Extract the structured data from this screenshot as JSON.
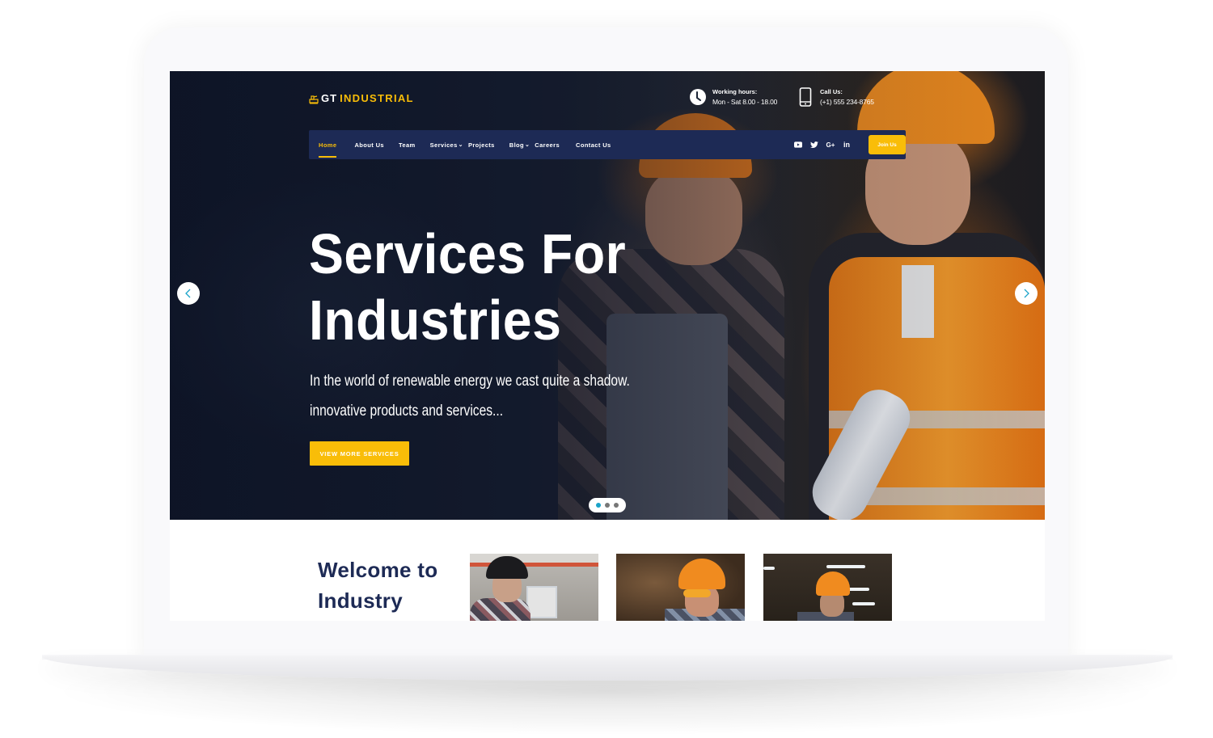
{
  "brand": {
    "prefix": "GT",
    "name": "INDUSTRIAL",
    "icon": "factory-icon",
    "accent_color": "#f9bd08",
    "navy_color": "#1d2a55"
  },
  "header_info": [
    {
      "icon": "clock-icon",
      "label": "Working hours:",
      "value": "Mon - Sat 8.00 - 18.00"
    },
    {
      "icon": "phone-icon",
      "label": "Call Us:",
      "value": "(+1) 555 234-8765"
    }
  ],
  "nav": {
    "items": [
      {
        "label": "Home",
        "active": true,
        "has_dropdown": false
      },
      {
        "label": "About Us",
        "active": false,
        "has_dropdown": false
      },
      {
        "label": "Team",
        "active": false,
        "has_dropdown": false
      },
      {
        "label": "Services",
        "active": false,
        "has_dropdown": true
      },
      {
        "label": "Projects",
        "active": false,
        "has_dropdown": false
      },
      {
        "label": "Blog",
        "active": false,
        "has_dropdown": true
      },
      {
        "label": "Careers",
        "active": false,
        "has_dropdown": false
      },
      {
        "label": "Contact Us",
        "active": false,
        "has_dropdown": false
      }
    ],
    "caret": "⌄",
    "social": [
      "youtube-icon",
      "twitter-icon",
      "google-plus-icon",
      "linkedin-icon"
    ],
    "social_glyphs": {
      "google_plus": "G+",
      "linkedin": "in"
    },
    "join_label": "Join Us"
  },
  "hero": {
    "title_line1": "Services For",
    "title_line2": "Industries",
    "subtitle_line1": "In the world of renewable energy we cast quite a shadow.",
    "subtitle_line2": "innovative products and services...",
    "cta_label": "VIEW MORE SERVICES",
    "slides_total": 3,
    "active_slide": 1,
    "dot_active_color": "#1aa3c9"
  },
  "welcome": {
    "title_line1": "Welcome to",
    "title_line2": "Industry",
    "thumbnails": [
      {
        "alt": "worker in cap at control panel"
      },
      {
        "alt": "worker in orange helmet at machine"
      },
      {
        "alt": "worker in orange helmet in warehouse"
      }
    ]
  }
}
